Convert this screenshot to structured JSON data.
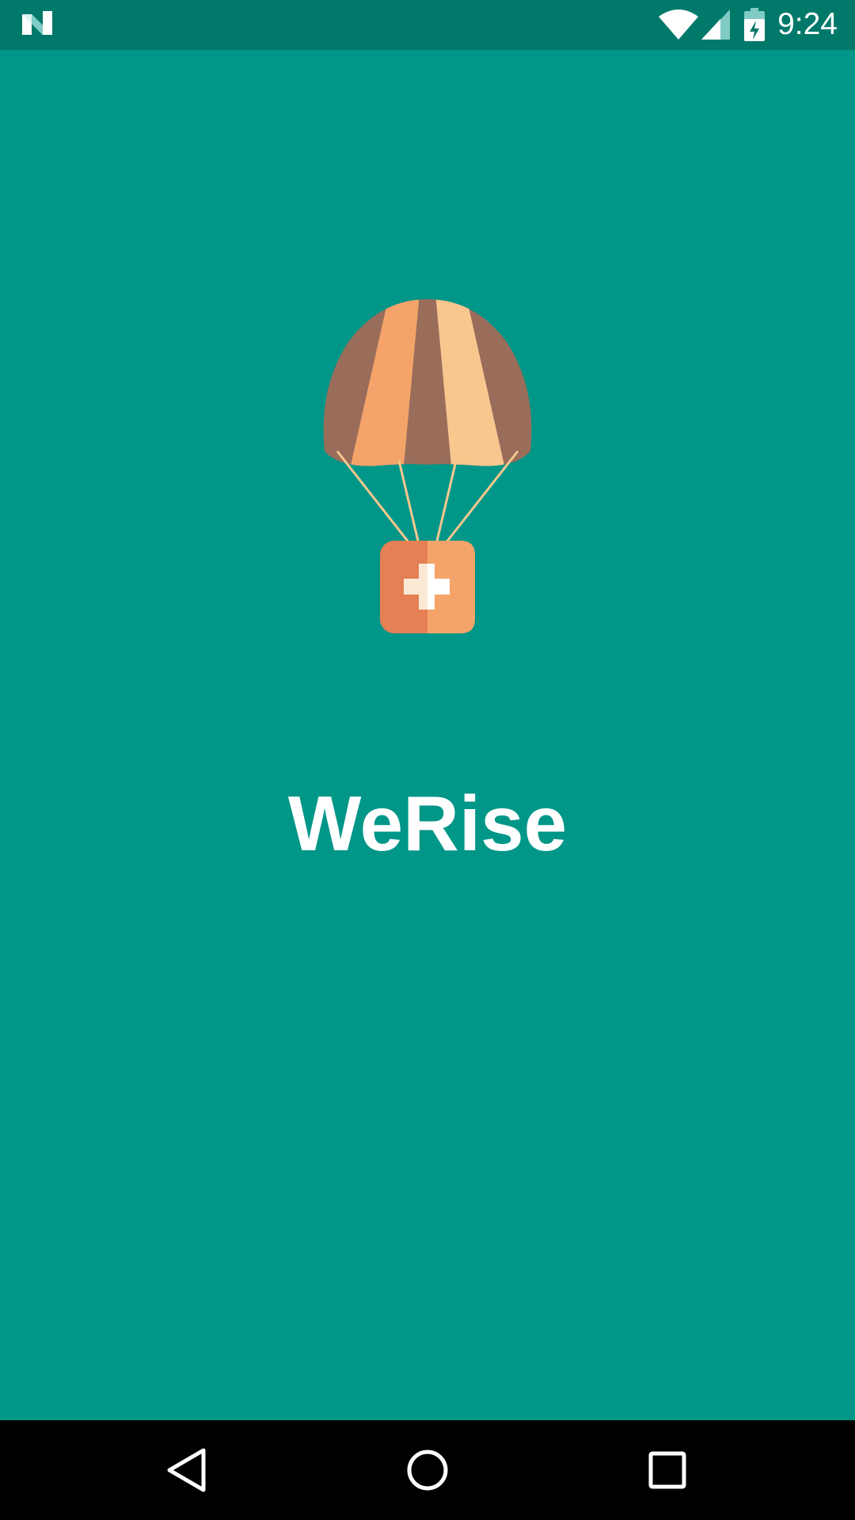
{
  "status_bar": {
    "time": "9:24",
    "icons": [
      "app-notification-icon",
      "wifi-icon",
      "cell-signal-icon",
      "battery-charging-icon"
    ],
    "background": "#00796B"
  },
  "app": {
    "name": "WeRise",
    "logo_icon": "parachute-medkit-icon",
    "background": "#009688"
  },
  "nav_bar": {
    "buttons": [
      "back-icon",
      "home-icon",
      "recents-icon"
    ],
    "background": "#000000"
  }
}
